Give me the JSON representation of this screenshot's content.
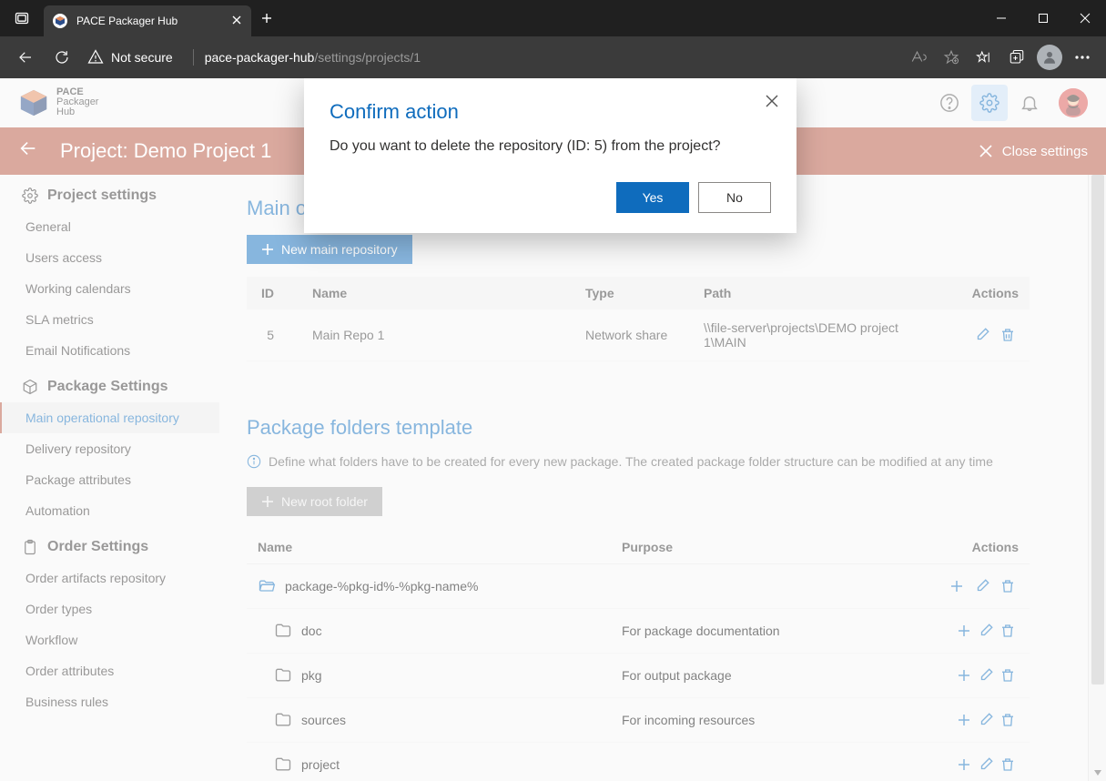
{
  "browser": {
    "tab_title": "PACE Packager Hub",
    "security_label": "Not secure",
    "url_host": "pace-packager-hub",
    "url_path": "/settings/projects/1"
  },
  "app": {
    "logo_line1": "PACE",
    "logo_line2": "Packager",
    "logo_line3": "Hub"
  },
  "project_bar": {
    "title": "Project: Demo Project 1",
    "close_label": "Close settings"
  },
  "sidebar": {
    "groups": [
      {
        "title": "Project settings",
        "icon": "gear",
        "items": [
          "General",
          "Users access",
          "Working calendars",
          "SLA metrics",
          "Email Notifications"
        ]
      },
      {
        "title": "Package Settings",
        "icon": "package",
        "items": [
          "Main operational repository",
          "Delivery repository",
          "Package attributes",
          "Automation"
        ],
        "selected": 0
      },
      {
        "title": "Order Settings",
        "icon": "clipboard",
        "items": [
          "Order artifacts repository",
          "Order types",
          "Workflow",
          "Order attributes",
          "Business rules"
        ]
      }
    ]
  },
  "main_repo": {
    "heading": "Main operational repository",
    "heading_visible": "Main o",
    "new_btn": "New main repository",
    "new_btn_visible": "New",
    "columns": {
      "id": "ID",
      "name": "Name",
      "type": "Type",
      "path": "Path",
      "actions": "Actions"
    },
    "rows": [
      {
        "id": "5",
        "name": "Main Repo 1",
        "type": "Network share",
        "path": "\\\\file-server\\projects\\DEMO project 1\\MAIN"
      }
    ]
  },
  "folders": {
    "heading": "Package folders template",
    "info": "Define what folders have to be created for every new package. The created package folder structure can be modified at any time",
    "new_btn": "New root folder",
    "columns": {
      "name": "Name",
      "purpose": "Purpose",
      "actions": "Actions"
    },
    "rows": [
      {
        "name": "package-%pkg-id%-%pkg-name%",
        "purpose": "",
        "root": true
      },
      {
        "name": "doc",
        "purpose": "For package documentation"
      },
      {
        "name": "pkg",
        "purpose": "For output package"
      },
      {
        "name": "sources",
        "purpose": "For incoming resources"
      },
      {
        "name": "project",
        "purpose": ""
      }
    ]
  },
  "modal": {
    "title": "Confirm action",
    "message": "Do you want to delete the repository (ID: 5) from the project?",
    "yes": "Yes",
    "no": "No"
  }
}
